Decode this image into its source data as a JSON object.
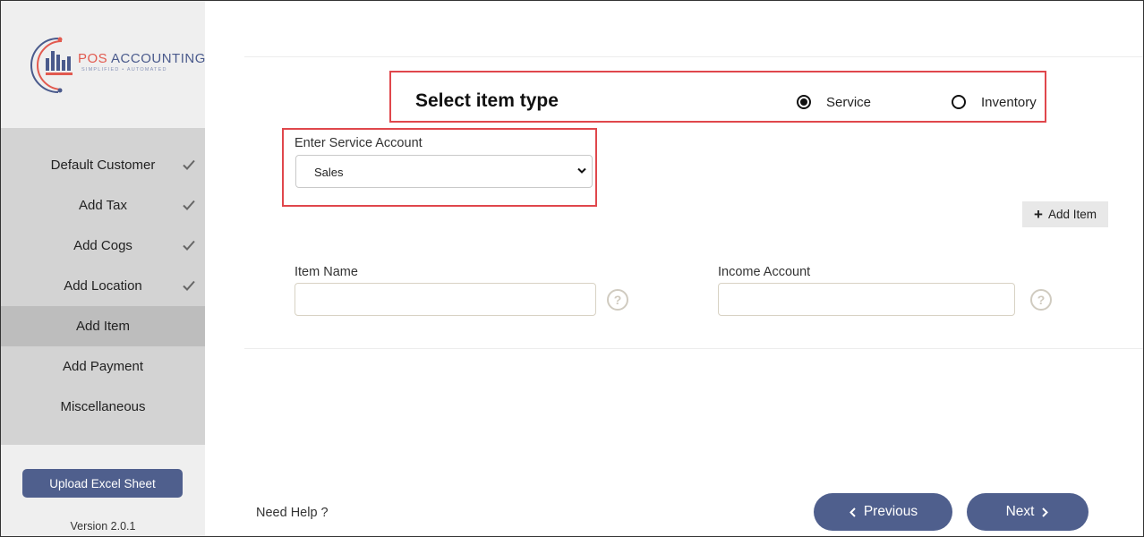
{
  "sidebar": {
    "logo": {
      "brand_pos": "POS",
      "brand_rest": " ACCOUNTING",
      "tagline": "SIMPLIFIED • AUTOMATED"
    },
    "nav": [
      {
        "label": "Default Customer",
        "done": true
      },
      {
        "label": "Add Tax",
        "done": true
      },
      {
        "label": "Add Cogs",
        "done": true
      },
      {
        "label": "Add Location",
        "done": true
      },
      {
        "label": "Add Item",
        "done": false,
        "active": true
      },
      {
        "label": "Add Payment",
        "done": false
      },
      {
        "label": "Miscellaneous",
        "done": false
      }
    ],
    "upload_label": "Upload Excel Sheet",
    "version": "Version 2.0.1"
  },
  "item_type": {
    "title": "Select item type",
    "options": [
      {
        "label": "Service",
        "selected": true
      },
      {
        "label": "Inventory",
        "selected": false
      }
    ]
  },
  "service_account": {
    "label": "Enter Service Account",
    "selected": "Sales"
  },
  "add_item_label": "Add Item",
  "item_form": {
    "item_name_label": "Item Name",
    "item_name_value": "",
    "income_account_label": "Income Account",
    "income_account_value": "",
    "help_glyph": "?"
  },
  "footer": {
    "need_help": "Need Help ?",
    "previous_label": "Previous",
    "next_label": "Next"
  },
  "colors": {
    "accent": "#4f5f8d",
    "highlight_border": "#e0474c",
    "brand_red": "#e25a4f"
  }
}
